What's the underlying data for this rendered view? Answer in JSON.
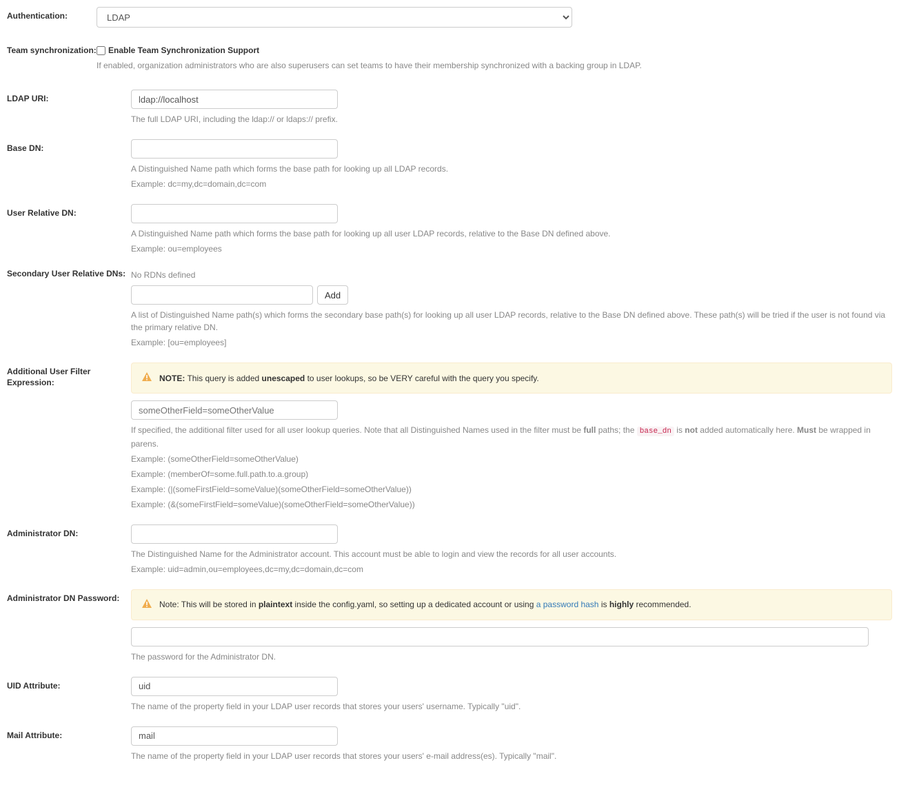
{
  "authentication": {
    "label": "Authentication:",
    "value": "LDAP"
  },
  "team_sync": {
    "label": "Team synchronization:",
    "checkbox_label": "Enable Team Synchronization Support",
    "checked": false,
    "help": "If enabled, organization administrators who are also superusers can set teams to have their membership synchronized with a backing group in LDAP."
  },
  "ldap_uri": {
    "label": "LDAP URI:",
    "value": "ldap://localhost",
    "help": "The full LDAP URI, including the ldap:// or ldaps:// prefix."
  },
  "base_dn": {
    "label": "Base DN:",
    "value": "",
    "help1": "A Distinguished Name path which forms the base path for looking up all LDAP records.",
    "help2": "Example: dc=my,dc=domain,dc=com"
  },
  "user_rel_dn": {
    "label": "User Relative DN:",
    "value": "",
    "help1": "A Distinguished Name path which forms the base path for looking up all user LDAP records, relative to the Base DN defined above.",
    "help2": "Example: ou=employees"
  },
  "secondary_rdn": {
    "label": "Secondary User Relative DNs:",
    "empty": "No RDNs defined",
    "add_label": "Add",
    "help1": "A list of Distinguished Name path(s) which forms the secondary base path(s) for looking up all user LDAP records, relative to the Base DN defined above. These path(s) will be tried if the user is not found via the primary relative DN.",
    "help2": "Example: [ou=employees]"
  },
  "filter_expr": {
    "label": "Additional User Filter Expression:",
    "note_prefix": "NOTE:",
    "note_before_u": " This query is added ",
    "note_unescaped": "unescaped",
    "note_after_u": " to user lookups, so be VERY careful with the query you specify.",
    "placeholder": "someOtherField=someOtherValue",
    "help1a": "If specified, the additional filter used for all user lookup queries. Note that all Distinguished Names used in the filter must be ",
    "help1_full": "full",
    "help1b": " paths; the ",
    "help1_code": "base_dn",
    "help1c": " is ",
    "help1_not": "not",
    "help1d": " added automatically here. ",
    "help1_must": "Must",
    "help1e": " be wrapped in parens.",
    "ex1": "Example: (someOtherField=someOtherValue)",
    "ex2": "Example: (memberOf=some.full.path.to.a.group)",
    "ex3": "Example: (|(someFirstField=someValue)(someOtherField=someOtherValue))",
    "ex4": "Example: (&(someFirstField=someValue)(someOtherField=someOtherValue))"
  },
  "admin_dn": {
    "label": "Administrator DN:",
    "value": "",
    "help1": "The Distinguished Name for the Administrator account. This account must be able to login and view the records for all user accounts.",
    "help2": "Example: uid=admin,ou=employees,dc=my,dc=domain,dc=com"
  },
  "admin_pw": {
    "label": "Administrator DN Password:",
    "note_a": "Note: This will be stored in ",
    "note_plain": "plaintext",
    "note_b": " inside the config.yaml, so setting up a dedicated account or using ",
    "note_link": "a password hash",
    "note_c": " is ",
    "note_highly": "highly",
    "note_d": " recommended.",
    "help": "The password for the Administrator DN."
  },
  "uid_attr": {
    "label": "UID Attribute:",
    "value": "uid",
    "help": "The name of the property field in your LDAP user records that stores your users' username. Typically \"uid\"."
  },
  "mail_attr": {
    "label": "Mail Attribute:",
    "value": "mail",
    "help": "The name of the property field in your LDAP user records that stores your users' e-mail address(es). Typically \"mail\"."
  }
}
